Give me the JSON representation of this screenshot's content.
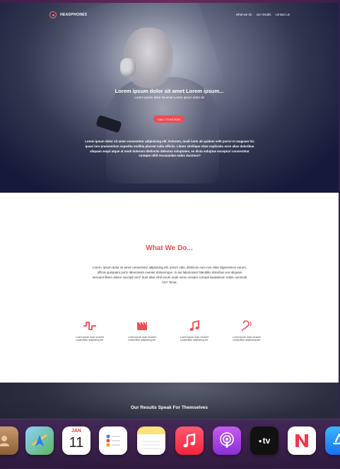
{
  "nav": {
    "logo_text": "HEADPHONES",
    "links": [
      "what we do",
      "our results",
      "contact us"
    ]
  },
  "hero": {
    "title": "Lorem ipsum dolor sit amet Lorem ipsum...",
    "subtitle": "Lorem ipsum dolor sit amet Lorem ipsum dolor sit",
    "cta_label": "CALL TO ACTION",
    "body": "Lorem ipsum dolor sit amet consectetur adipisicing elit. Dolorem, modi iusto ab quidem velit porro! In magnam hic quasi iure praesentium expedita mollitia placeat nulla officiis. Libero similique vitae explicabo esse alias doloribus aliquam sequi atque at modi dolorum distinctio delectus voluptates, ex dicta voluptas excepturi consectetur cumque nihil recusandae nobis ducimus?"
  },
  "what_we_do": {
    "title": "What We Do...",
    "body": "Lorem, ipsum dolor sit amet consectetur adipisicing elit. Ipsum odio, distinctio eum non vitae dignissimos earum, officiis quisquam porro laboriosam eveniet doloremque. In aut laboriosam blanditiis doloribus eos aliquam nesciunt libero dolore suscipit non? Sunt alias nihil rerum unde nemo veniam corrupti laudantium nobis commodi hic? Tenet.",
    "features": [
      {
        "icon": "waveform-icon",
        "caption": "Lorem ipsum dolor sit amet consectetur adipisicing elit."
      },
      {
        "icon": "clapperboard-icon",
        "caption": "Lorem ipsum dolor sit amet consectetur adipisicing elit."
      },
      {
        "icon": "music-note-icon",
        "caption": "Lorem ipsum dolor sit amet consectetur adipisicing elit."
      },
      {
        "icon": "assistive-listening-icon",
        "caption": "Lorem ipsum dolor sit amet consectetur adipisicing elit."
      }
    ],
    "accent_color": "#ef4c52"
  },
  "results": {
    "title": "Our Results Speak For Themselves"
  },
  "dock": {
    "calendar_month": "JAN",
    "calendar_day": "11",
    "tv_label": "tv",
    "apps": [
      "contacts-icon",
      "maps-icon",
      "calendar-icon",
      "reminders-icon",
      "notes-icon",
      "music-icon",
      "podcasts-icon",
      "apple-tv-icon",
      "news-icon",
      "app-store-icon"
    ]
  }
}
